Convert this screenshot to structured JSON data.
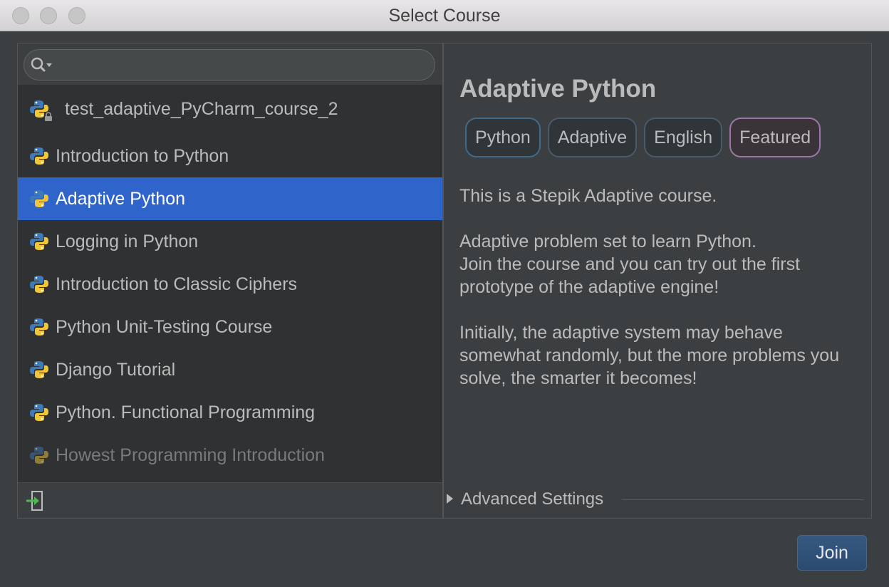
{
  "window": {
    "title": "Select Course"
  },
  "search": {
    "placeholder": ""
  },
  "courses": [
    {
      "label": "test_adaptive_PyCharm_course_2",
      "locked": true,
      "state": "normal"
    },
    {
      "label": "Introduction to Python",
      "state": "normal"
    },
    {
      "label": "Adaptive Python",
      "state": "selected"
    },
    {
      "label": "Logging in Python",
      "state": "normal"
    },
    {
      "label": "Introduction to Classic Ciphers",
      "state": "normal"
    },
    {
      "label": "Python Unit-Testing Course",
      "state": "normal"
    },
    {
      "label": "Django Tutorial",
      "state": "normal"
    },
    {
      "label": "Python. Functional Programming",
      "state": "normal"
    },
    {
      "label": "Howest Programming Introduction",
      "state": "disabled"
    }
  ],
  "details": {
    "title": "Adaptive Python",
    "tags": [
      "Python",
      "Adaptive",
      "English",
      "Featured"
    ],
    "description": [
      "This is a Stepik Adaptive course.",
      "Adaptive problem set to learn Python.\nJoin the course and you can try out the first prototype of the adaptive engine!",
      "Initially, the adaptive system may behave somewhat randomly, but the more problems you solve, the smarter it becomes!"
    ],
    "advanced_label": "Advanced Settings"
  },
  "actions": {
    "join_label": "Join"
  },
  "colors": {
    "selection": "#2f65ca",
    "background": "#3c3f41",
    "list_background": "#2f3133",
    "join_button": "#365880"
  },
  "icons": {
    "course": "python-icon",
    "lock": "lock-icon",
    "search": "search-icon",
    "import": "import-course-icon"
  }
}
